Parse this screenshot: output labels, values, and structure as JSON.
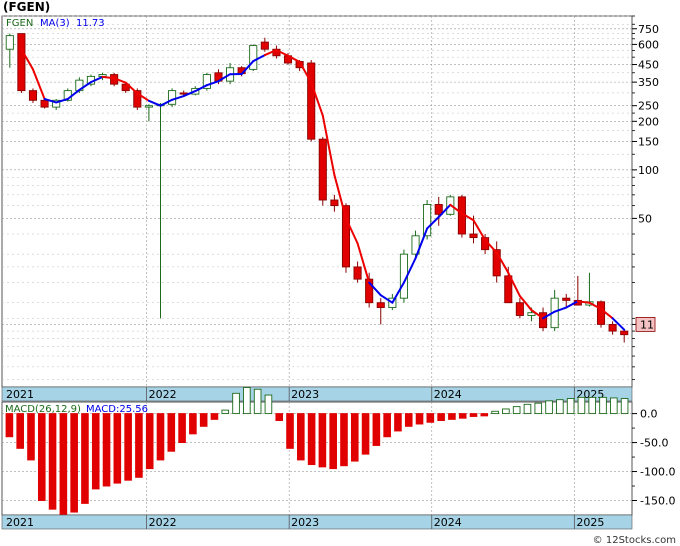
{
  "header": {
    "title": "(FGEN)"
  },
  "colors": {
    "up_body": "#ffffff",
    "up_border": "#1a6a1a",
    "down_body": "#e00000",
    "down_border": "#8a0000",
    "ma_up": "#0000ee",
    "ma_down": "#ee0000",
    "hist_up": "#1a6a1a",
    "hist_down": "#e00000",
    "date_strip": "#a6d3e6",
    "grid": "#999999",
    "price_tag_bg": "#f4c2c2"
  },
  "chart_data": [
    {
      "type": "candlestick",
      "name": "price",
      "legend": {
        "symbol": "FGEN",
        "ma_label": "MA(3)",
        "ma_value": "11.73"
      },
      "scale": "log",
      "ylim": [
        4.5,
        900
      ],
      "yticks": [
        750,
        600,
        450,
        350,
        250,
        200,
        150,
        100,
        50,
        11
      ],
      "ytick_labels": [
        "750",
        "600",
        "450",
        "350",
        "250",
        "200",
        "150",
        "100",
        "50"
      ],
      "minor_ticks": [
        900,
        800,
        700,
        650,
        550,
        500,
        400,
        300,
        225,
        175,
        125,
        90,
        80,
        70,
        60,
        40,
        30,
        25,
        20,
        15,
        12,
        10,
        9,
        8,
        7,
        6,
        5
      ],
      "current_price_label": "11",
      "current_price": 11,
      "x_labels": [
        {
          "label": "2021",
          "index": 0
        },
        {
          "label": "2022",
          "index": 12.3
        },
        {
          "label": "2023",
          "index": 24.6
        },
        {
          "label": "2024",
          "index": 36.9
        },
        {
          "label": "2025",
          "index": 49.2
        }
      ],
      "x_count": 54,
      "candles": [
        [
          560,
          700,
          430,
          680
        ],
        [
          700,
          700,
          300,
          310
        ],
        [
          310,
          320,
          260,
          270
        ],
        [
          270,
          280,
          240,
          245
        ],
        [
          245,
          275,
          235,
          270
        ],
        [
          270,
          320,
          265,
          310
        ],
        [
          310,
          375,
          300,
          360
        ],
        [
          340,
          390,
          330,
          380
        ],
        [
          380,
          400,
          360,
          390
        ],
        [
          390,
          400,
          330,
          340
        ],
        [
          340,
          345,
          300,
          310
        ],
        [
          310,
          320,
          235,
          245
        ],
        [
          245,
          255,
          200,
          250
        ],
        [
          250,
          260,
          12,
          255
        ],
        [
          255,
          320,
          245,
          310
        ],
        [
          300,
          310,
          285,
          295
        ],
        [
          295,
          330,
          290,
          320
        ],
        [
          320,
          400,
          310,
          390
        ],
        [
          400,
          420,
          340,
          355
        ],
        [
          355,
          460,
          340,
          430
        ],
        [
          430,
          440,
          380,
          395
        ],
        [
          420,
          600,
          410,
          590
        ],
        [
          620,
          660,
          540,
          560
        ],
        [
          560,
          590,
          490,
          510
        ],
        [
          510,
          530,
          450,
          460
        ],
        [
          470,
          480,
          410,
          430
        ],
        [
          460,
          480,
          150,
          155
        ],
        [
          155,
          160,
          60,
          65
        ],
        [
          65,
          70,
          55,
          60
        ],
        [
          60,
          62,
          23,
          25
        ],
        [
          25,
          27,
          20,
          21
        ],
        [
          21,
          23,
          14,
          15
        ],
        [
          15,
          16,
          11,
          14
        ],
        [
          14,
          17,
          13.5,
          16
        ],
        [
          16,
          32,
          15,
          30
        ],
        [
          30,
          42,
          28,
          39
        ],
        [
          39,
          65,
          37,
          61
        ],
        [
          61,
          68,
          45,
          53
        ],
        [
          53,
          70,
          52,
          68
        ],
        [
          68,
          70,
          38,
          40
        ],
        [
          40,
          52,
          35,
          38
        ],
        [
          38,
          40,
          30,
          32
        ],
        [
          32,
          36,
          20,
          22
        ],
        [
          22,
          25,
          15,
          15
        ],
        [
          15,
          16,
          12,
          12.5
        ],
        [
          12.5,
          14,
          11.5,
          13
        ],
        [
          13,
          14,
          10,
          10.5
        ],
        [
          10.5,
          18,
          10,
          16
        ],
        [
          16,
          17,
          14,
          15.5
        ],
        [
          15.5,
          22,
          14.5,
          14.5
        ],
        [
          14.5,
          23,
          14.2,
          15.2
        ],
        [
          15.2,
          15.5,
          10.5,
          11
        ],
        [
          11,
          11.5,
          9.5,
          10
        ],
        [
          10,
          10.2,
          8.5,
          9.5
        ]
      ],
      "ma": [
        null,
        560,
        420,
        275,
        262,
        275,
        313,
        350,
        377,
        370,
        347,
        298,
        268,
        250,
        272,
        287,
        308,
        335,
        355,
        392,
        393,
        472,
        515,
        553,
        510,
        467,
        348,
        217,
        93,
        50,
        35,
        20,
        16.7,
        15,
        20,
        28.3,
        43.3,
        51,
        60.7,
        53.7,
        48.7,
        36.7,
        30.7,
        23,
        16.5,
        13.5,
        12,
        13.2,
        14,
        15.3,
        15,
        13.7,
        12,
        10.2
      ],
      "ma_direction": [
        "down",
        "down",
        "down",
        "down",
        "up",
        "up",
        "up",
        "up",
        "up",
        "down",
        "down",
        "down",
        "down",
        "up",
        "up",
        "up",
        "up",
        "up",
        "up",
        "up",
        "up",
        "up",
        "up",
        "down",
        "down",
        "down",
        "down",
        "down",
        "down",
        "down",
        "down",
        "down",
        "up",
        "up",
        "up",
        "up",
        "up",
        "up",
        "up",
        "down",
        "down",
        "down",
        "down",
        "down",
        "down",
        "down",
        "down",
        "up",
        "up",
        "up",
        "down",
        "down",
        "down",
        "up"
      ]
    },
    {
      "type": "bar",
      "name": "macd",
      "legend": {
        "label": "MACD(26,12,9)",
        "value_label": "MACD:25.56"
      },
      "ylim": [
        -175,
        20
      ],
      "yticks": [
        0,
        -50,
        -100,
        -150
      ],
      "ytick_labels": [
        "0.0",
        "-50.0",
        "-100.0",
        "-150.0"
      ],
      "values": [
        -40,
        -60,
        -80,
        -150,
        -165,
        -175,
        -170,
        -155,
        -130,
        -125,
        -120,
        -115,
        -110,
        -95,
        -80,
        -65,
        -50,
        -35,
        -22,
        -10,
        6,
        35,
        45,
        42,
        32,
        -12,
        -60,
        -80,
        -88,
        -92,
        -95,
        -90,
        -82,
        -70,
        -55,
        -40,
        -30,
        -22,
        -18,
        -15,
        -12,
        -10,
        -8,
        -5,
        -4,
        4,
        8,
        12,
        16,
        18,
        22,
        24,
        26,
        28,
        28,
        28,
        27,
        26
      ],
      "x_labels": [
        {
          "label": "2021",
          "index": 0
        },
        {
          "label": "2022",
          "index": 12.3
        },
        {
          "label": "2023",
          "index": 24.6
        },
        {
          "label": "2024",
          "index": 36.9
        },
        {
          "label": "2025",
          "index": 49.2
        }
      ]
    }
  ],
  "footer": {
    "watermark": "© 12Stocks.com"
  }
}
